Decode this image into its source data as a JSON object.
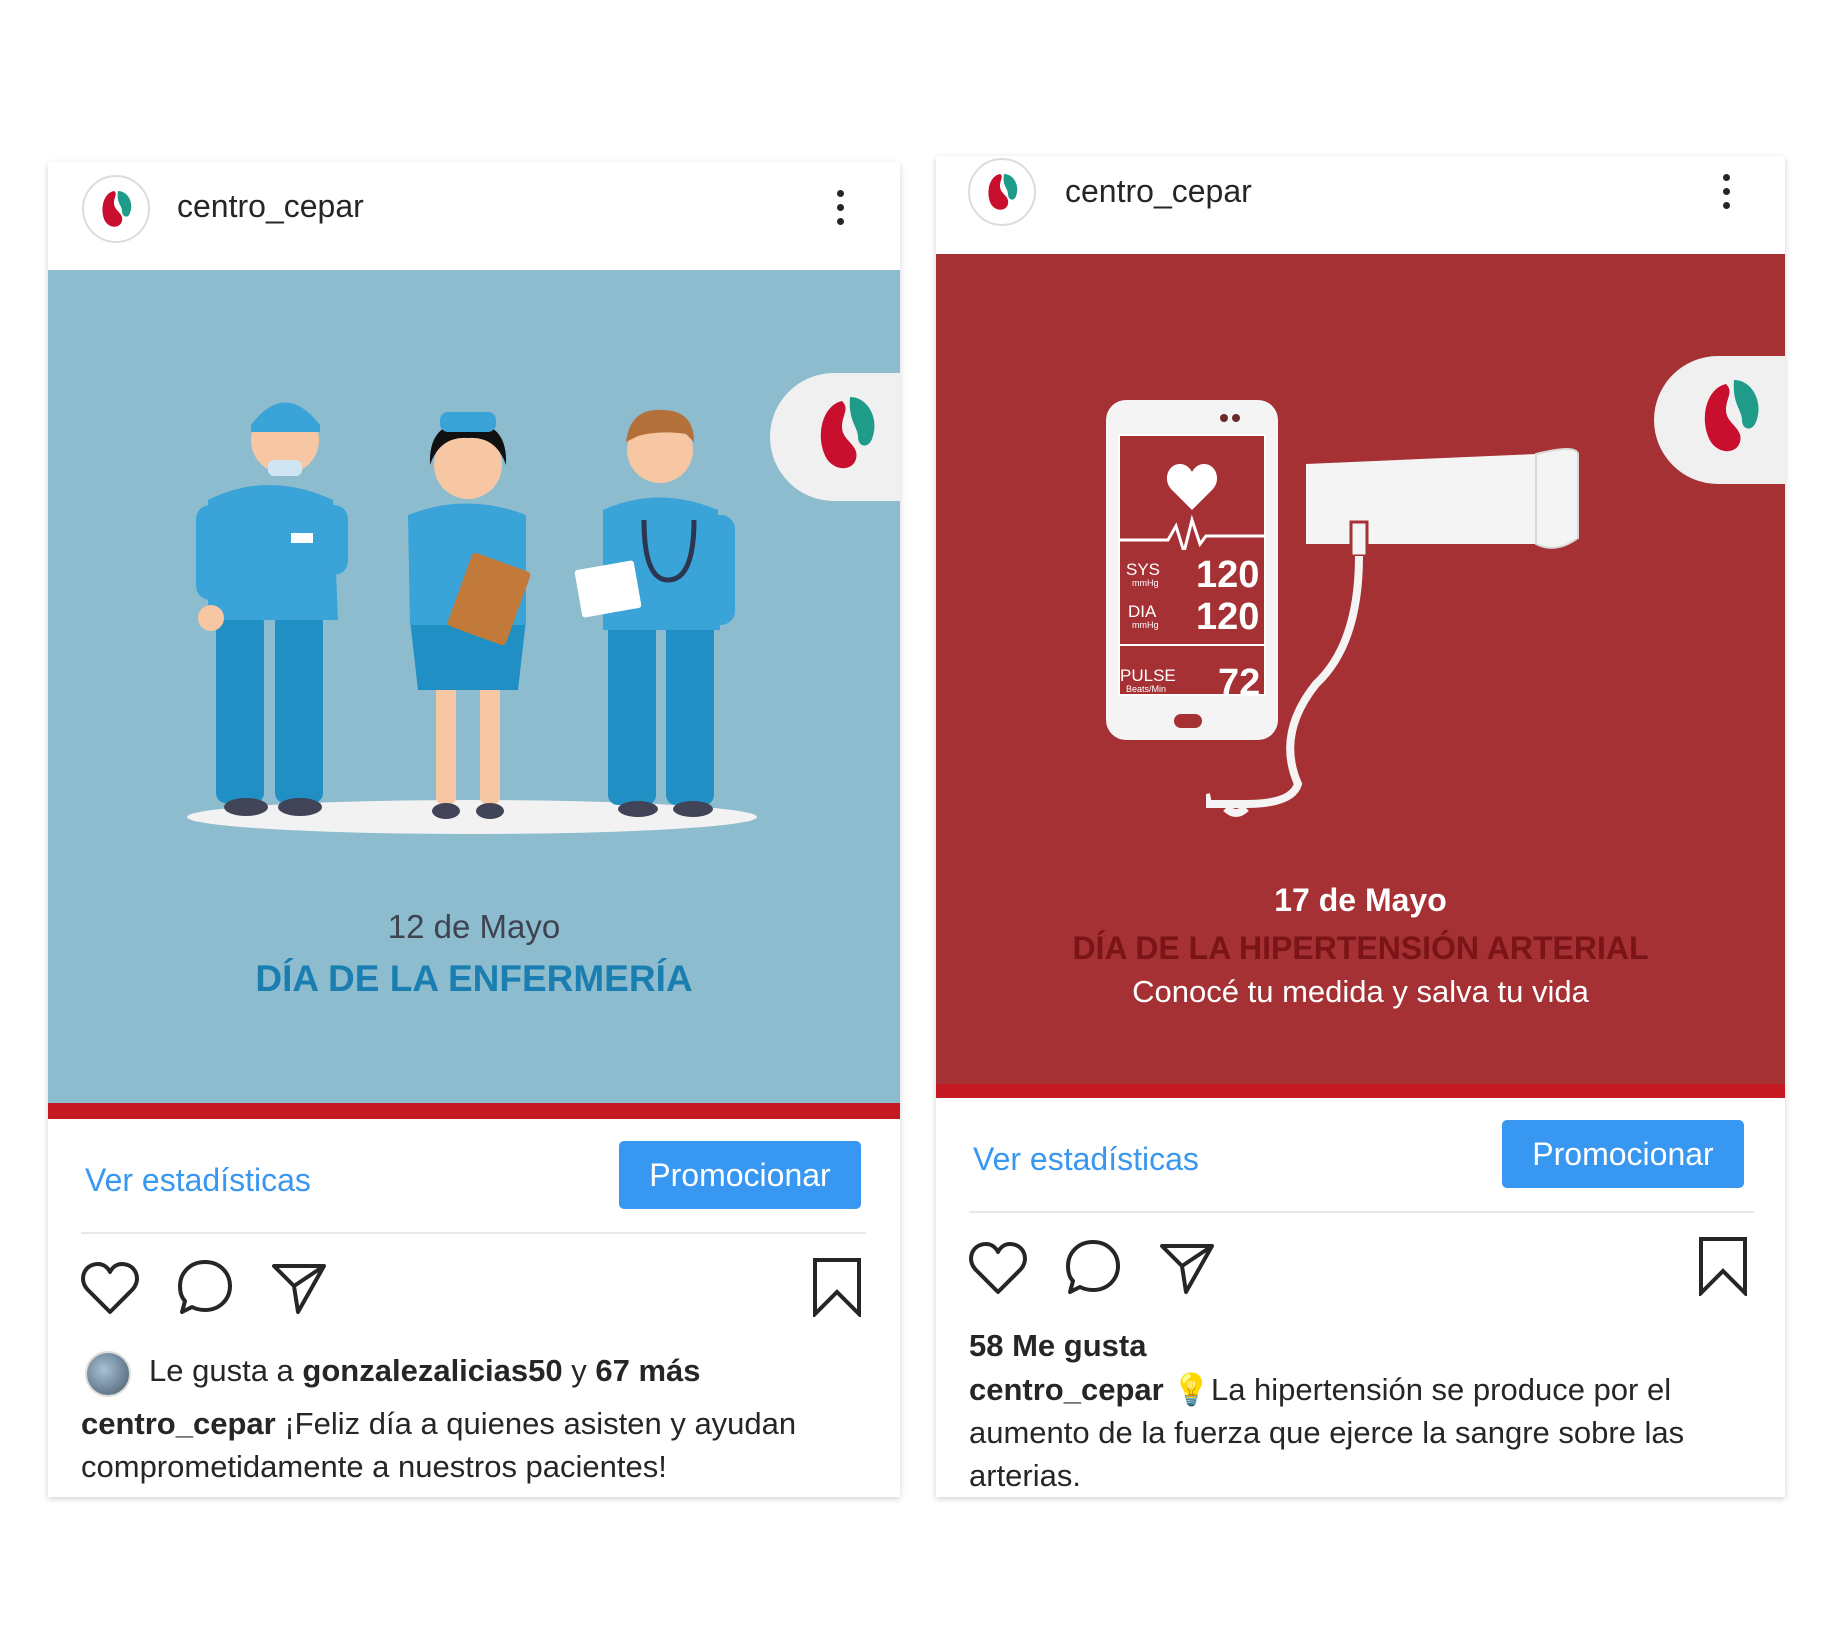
{
  "post1": {
    "username": "centro_cepar",
    "image": {
      "date": "12 de Mayo",
      "title": "DÍA DE LA ENFERMERÍA"
    },
    "stats_link": "Ver estadísticas",
    "promote_button": "Promocionar",
    "likes": {
      "prefix": "Le gusta a",
      "user": "gonzalezalicias50",
      "connector": "y",
      "more": "67 más"
    },
    "caption": {
      "user": "centro_cepar",
      "text": "¡Feliz día a quienes asisten y ayudan comprometidamente a nuestros pacientes!"
    }
  },
  "post2": {
    "username": "centro_cepar",
    "image": {
      "date": "17 de Mayo",
      "title": "DÍA DE LA HIPERTENSIÓN ARTERIAL",
      "subtitle": "Conocé tu medida y salva tu vida",
      "phone": {
        "sys_label": "SYS",
        "sys_unit": "mmHg",
        "sys_value": "120",
        "dia_label": "DIA",
        "dia_unit": "mmHg",
        "dia_value": "120",
        "pulse_label": "PULSE",
        "pulse_unit": "Beats/Min",
        "pulse_value": "72"
      }
    },
    "stats_link": "Ver estadísticas",
    "promote_button": "Promocionar",
    "likes": "58 Me gusta",
    "caption": {
      "user": "centro_cepar",
      "emoji": "💡",
      "text": "La hipertensión se produce por el aumento de la fuerza que ejerce la sangre sobre las arterias."
    }
  },
  "colors": {
    "accent": "#3897f0",
    "blue_bg": "#8dbccf",
    "red_bg": "#a53134",
    "strip": "#c51a23",
    "enf_title": "#1a7fb0",
    "hta_title": "#7a1416"
  }
}
